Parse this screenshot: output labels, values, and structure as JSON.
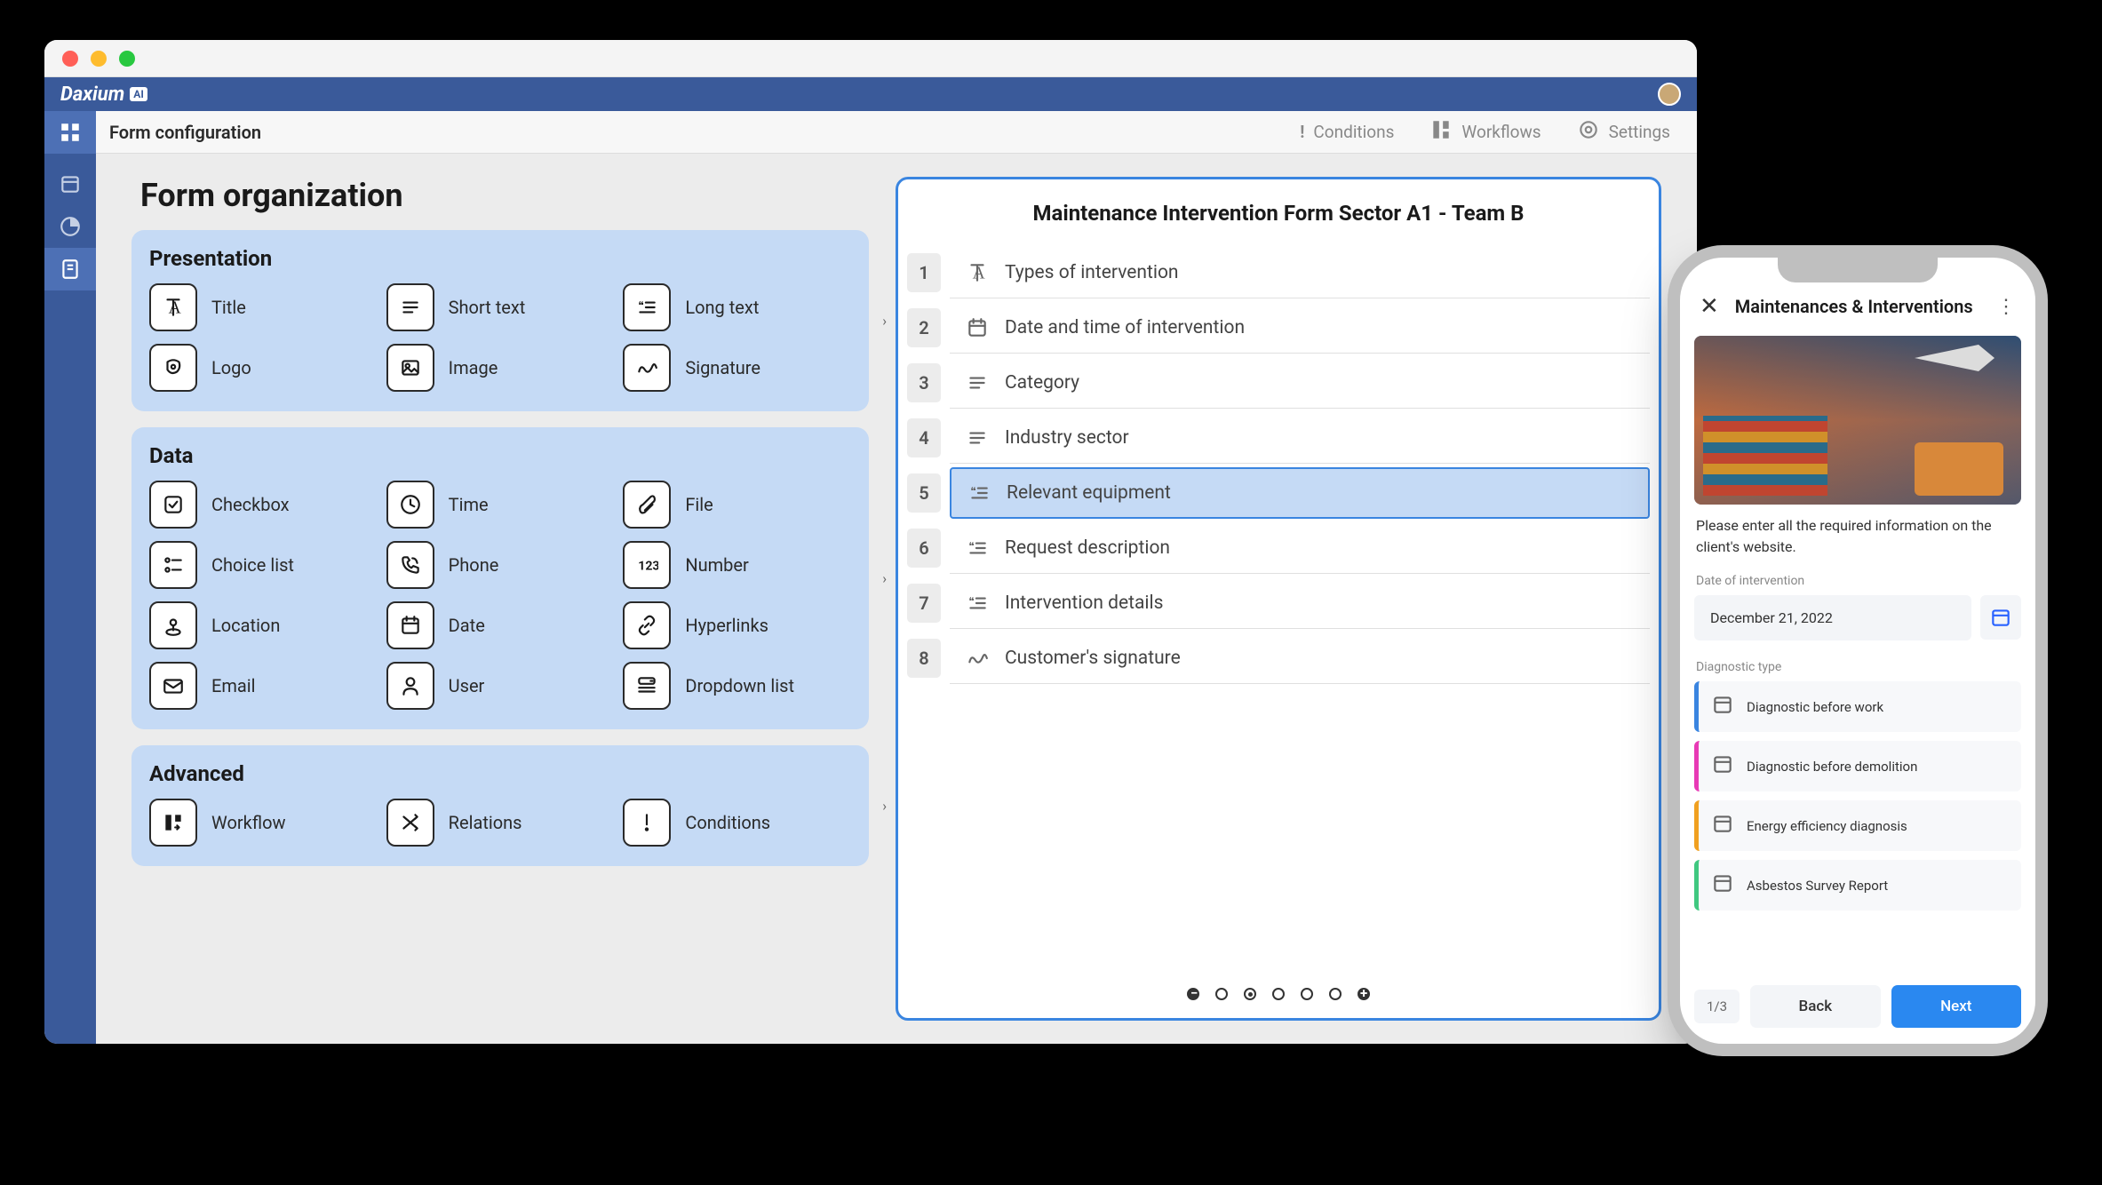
{
  "brand": "Daxium",
  "brand_badge": "AI",
  "breadcrumb": "Form configuration",
  "toolbar": {
    "conditions": "Conditions",
    "workflows": "Workflows",
    "settings": "Settings"
  },
  "page_title": "Form organization",
  "categories": [
    {
      "title": "Presentation",
      "fields": [
        {
          "icon": "title",
          "label": "Title"
        },
        {
          "icon": "shorttext",
          "label": "Short text"
        },
        {
          "icon": "longtext",
          "label": "Long text"
        },
        {
          "icon": "logo",
          "label": "Logo"
        },
        {
          "icon": "image",
          "label": "Image"
        },
        {
          "icon": "signature",
          "label": "Signature"
        }
      ]
    },
    {
      "title": "Data",
      "fields": [
        {
          "icon": "checkbox",
          "label": "Checkbox"
        },
        {
          "icon": "time",
          "label": "Time"
        },
        {
          "icon": "file",
          "label": "File"
        },
        {
          "icon": "choicelist",
          "label": "Choice list"
        },
        {
          "icon": "phone",
          "label": "Phone"
        },
        {
          "icon": "number",
          "label": "Number"
        },
        {
          "icon": "location",
          "label": "Location"
        },
        {
          "icon": "date",
          "label": "Date"
        },
        {
          "icon": "hyperlinks",
          "label": "Hyperlinks"
        },
        {
          "icon": "email",
          "label": "Email"
        },
        {
          "icon": "user",
          "label": "User"
        },
        {
          "icon": "dropdown",
          "label": "Dropdown list"
        }
      ]
    },
    {
      "title": "Advanced",
      "fields": [
        {
          "icon": "workflow",
          "label": "Workflow"
        },
        {
          "icon": "relations",
          "label": "Relations"
        },
        {
          "icon": "conditions",
          "label": "Conditions"
        }
      ]
    }
  ],
  "form_preview": {
    "title": "Maintenance Intervention Form Sector A1 - Team B",
    "rows": [
      {
        "num": "1",
        "icon": "title",
        "label": "Types of intervention",
        "selected": false
      },
      {
        "num": "2",
        "icon": "date",
        "label": "Date and time of intervention",
        "selected": false
      },
      {
        "num": "3",
        "icon": "shorttext",
        "label": "Category",
        "selected": false
      },
      {
        "num": "4",
        "icon": "shorttext",
        "label": "Industry sector",
        "selected": false
      },
      {
        "num": "5",
        "icon": "longtext",
        "label": "Relevant equipment",
        "selected": true
      },
      {
        "num": "6",
        "icon": "longtext",
        "label": "Request description",
        "selected": false
      },
      {
        "num": "7",
        "icon": "longtext",
        "label": "Intervention details",
        "selected": false
      },
      {
        "num": "8",
        "icon": "signature",
        "label": "Customer's signature",
        "selected": false
      }
    ]
  },
  "phone": {
    "title": "Maintenances & Interventions",
    "desc": "Please enter all the required information on the client's website.",
    "date_label": "Date of intervention",
    "date_value": "December 21, 2022",
    "diag_label": "Diagnostic type",
    "diags": [
      {
        "color": "#3a85e0",
        "label": "Diagnostic before work"
      },
      {
        "color": "#e83ab5",
        "label": "Diagnostic before demolition"
      },
      {
        "color": "#f0a020",
        "label": "Energy efficiency diagnosis"
      },
      {
        "color": "#40c880",
        "label": "Asbestos Survey Report"
      }
    ],
    "page": "1/3",
    "back": "Back",
    "next": "Next"
  }
}
